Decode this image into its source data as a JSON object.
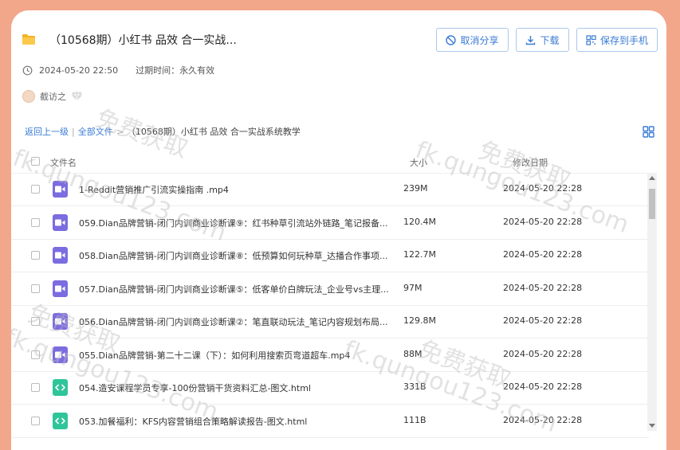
{
  "share": {
    "title": "（10568期）小红书 品效 合一实战...",
    "created": "2024-05-20 22:50",
    "expire_label": "过期时间：永久有效",
    "user": "截访之"
  },
  "buttons": {
    "cancel": "取消分享",
    "download": "下载",
    "save_phone": "保存到手机"
  },
  "breadcrumb": {
    "back": "返回上一级",
    "sep": "|",
    "all": "全部文件",
    "arrow": ">",
    "current": "（10568期）小红书 品效 合一实战系统教学"
  },
  "table": {
    "col_name": "文件名",
    "col_size": "大小",
    "col_date": "修改日期"
  },
  "files": [
    {
      "name": "1-Reddit营销推广引流实操指南 .mp4",
      "size": "239M",
      "date": "2024-05-20 22:28",
      "type": "video"
    },
    {
      "name": "059.Dian品牌营销-闭门内训商业诊断课⑨：红书种草引流站外链路_笔记报备...",
      "size": "120.4M",
      "date": "2024-05-20 22:28",
      "type": "video"
    },
    {
      "name": "058.Dian品牌营销-闭门内训商业诊断课⑧：低预算如何玩种草_达播合作事项...",
      "size": "122.7M",
      "date": "2024-05-20 22:28",
      "type": "video"
    },
    {
      "name": "057.Dian品牌营销-闭门内训商业诊断课⑤：低客单价白牌玩法_企业号vs主理...",
      "size": "97M",
      "date": "2024-05-20 22:28",
      "type": "video"
    },
    {
      "name": "056.Dian品牌营销-闭门内训商业诊断课②：笔直联动玩法_笔记内容规划布局...",
      "size": "129.8M",
      "date": "2024-05-20 22:28",
      "type": "video"
    },
    {
      "name": "055.Dian品牌营销-第二十二课（下）：如何利用搜索页弯道超车.mp4",
      "size": "88M",
      "date": "2024-05-20 22:28",
      "type": "video"
    },
    {
      "name": "054.造安课程学员专享-100份营销干货资料汇总-图文.html",
      "size": "331B",
      "date": "2024-05-20 22:28",
      "type": "html"
    },
    {
      "name": "053.加餐福利：KFS内容营销组合策略解读报告-图文.html",
      "size": "111B",
      "date": "2024-05-20 22:28",
      "type": "html"
    }
  ],
  "watermarks": [
    "免费获取",
    "fk.qungou123.com"
  ]
}
